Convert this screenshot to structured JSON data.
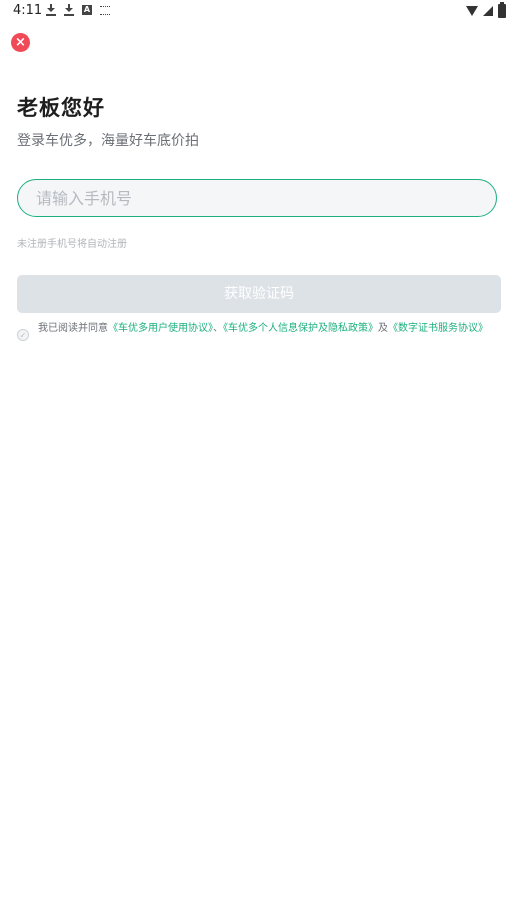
{
  "status_bar": {
    "time": "4:11"
  },
  "close_icon_glyph": "×",
  "login": {
    "title": "老板您好",
    "subtitle": "登录车优多，海量好车底价拍",
    "phone_placeholder": "请输入手机号",
    "phone_value": "",
    "hint": "未注册手机号将自动注册",
    "get_code_label": "获取验证码"
  },
  "agreement": {
    "prefix": "我已阅读并同意",
    "user_agreement": "《车优多用户使用协议》",
    "separator": "、",
    "privacy_policy": "《车优多个人信息保护及隐私政策》",
    "and": "及",
    "cert_agreement": "《数字证书服务协议》",
    "checkbox_glyph": "✓",
    "checked": false
  },
  "colors": {
    "accent": "#1db07f",
    "close": "#f04a57",
    "button_disabled": "#dde2e7"
  }
}
